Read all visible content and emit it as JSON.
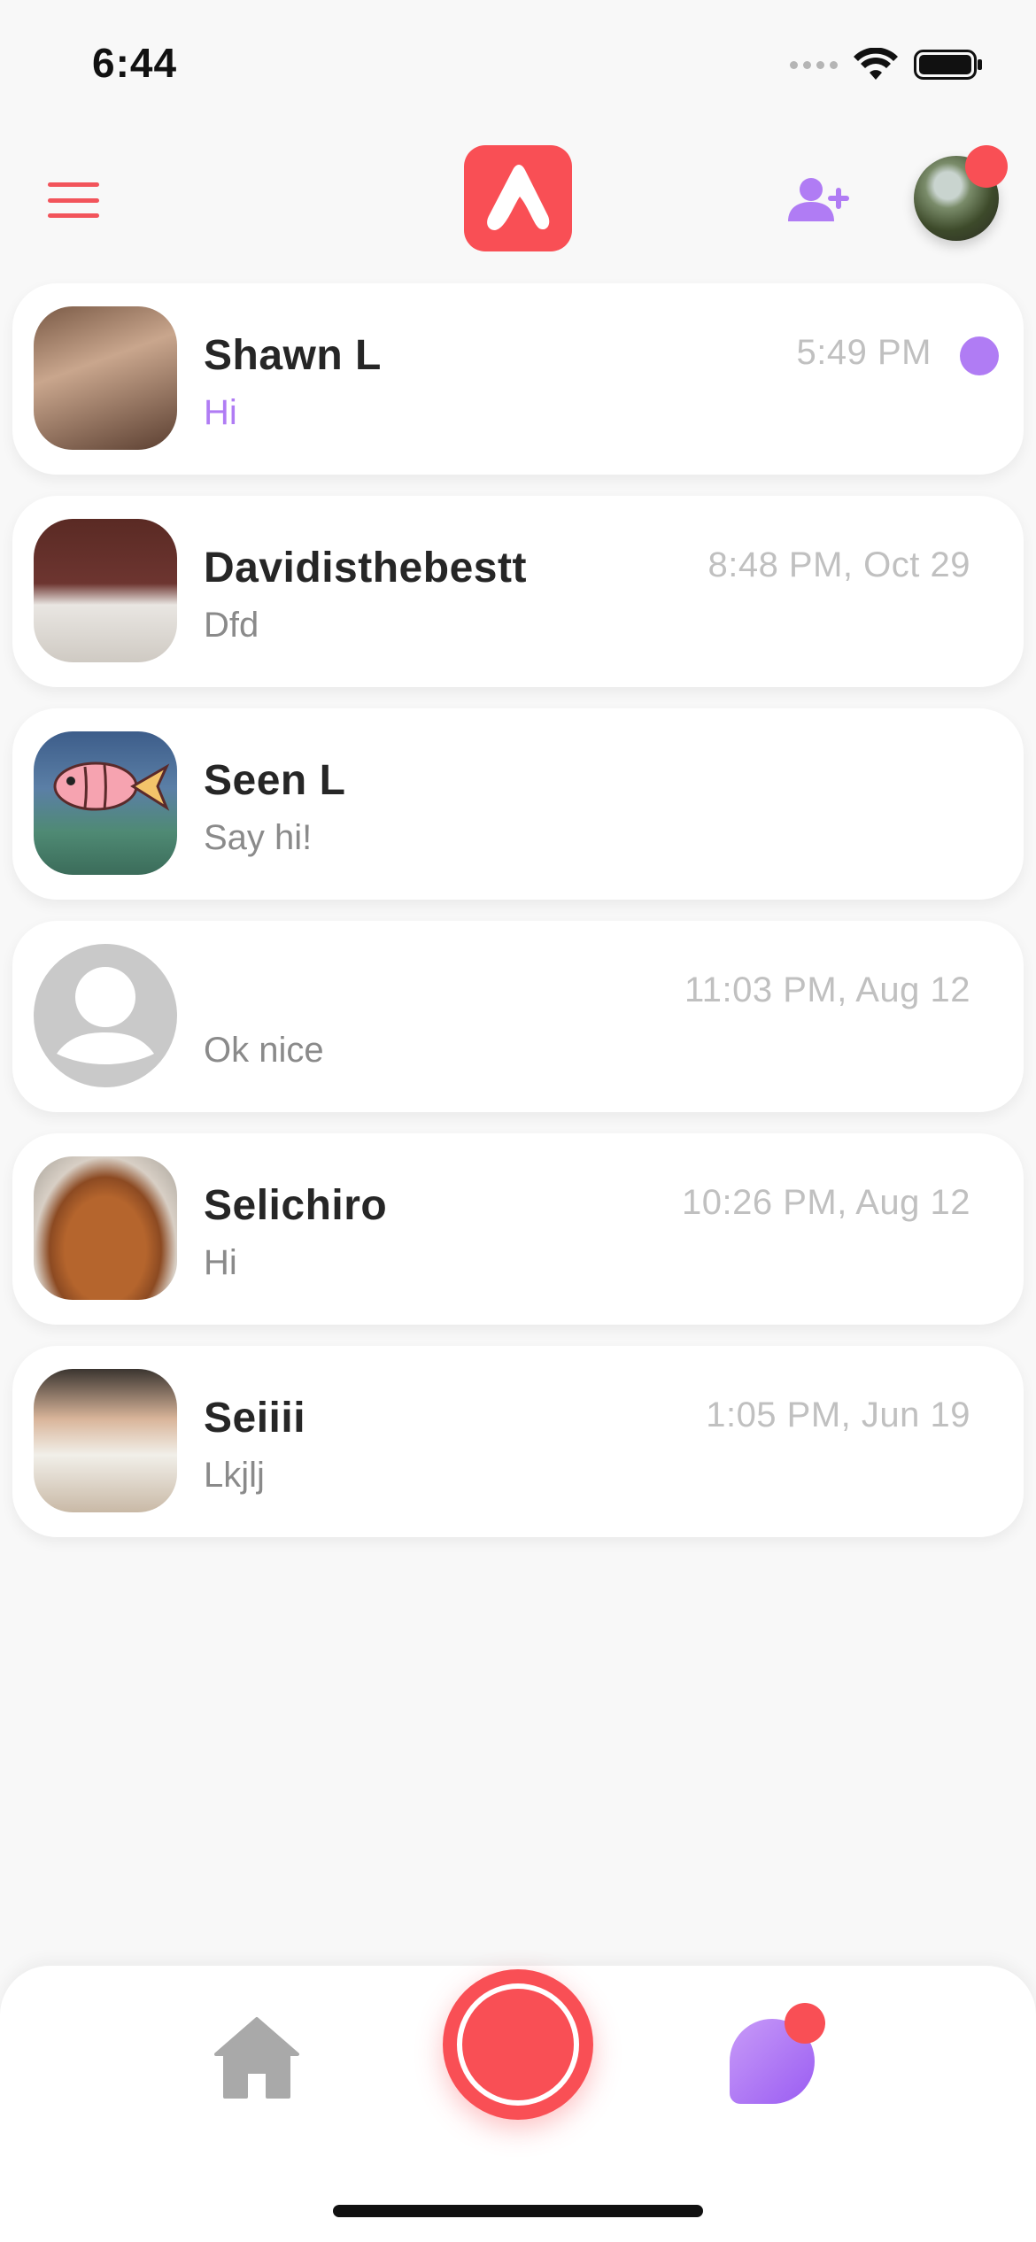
{
  "status_bar": {
    "time": "6:44"
  },
  "header": {
    "menu_icon": "hamburger-menu-icon",
    "logo_icon": "app-logo-icon",
    "add_friend_icon": "add-user-icon",
    "profile_has_notification": true
  },
  "chats": [
    {
      "name": "Shawn L",
      "preview": "Hi",
      "time": "5:49 PM",
      "unread": true
    },
    {
      "name": "Davidisthebestt",
      "preview": "Dfd",
      "time": "8:48 PM, Oct 29",
      "unread": false
    },
    {
      "name": "Seen L",
      "preview": "Say hi!",
      "time": "",
      "unread": false
    },
    {
      "name": "",
      "preview": "Ok nice",
      "time": "11:03 PM, Aug 12",
      "unread": false
    },
    {
      "name": "Selichiro",
      "preview": "Hi",
      "time": "10:26 PM, Aug 12",
      "unread": false
    },
    {
      "name": "Seiiii",
      "preview": "Lkjlj",
      "time": "1:05 PM, Jun 19",
      "unread": false
    }
  ],
  "bottom_nav": {
    "home_icon": "home-icon",
    "record_icon": "record-button-icon",
    "chats_icon": "chat-bubble-icon",
    "chats_has_notification": true
  },
  "colors": {
    "brand_red": "#f94f55",
    "accent_purple": "#b07cf4",
    "background": "#f8f8f8"
  }
}
